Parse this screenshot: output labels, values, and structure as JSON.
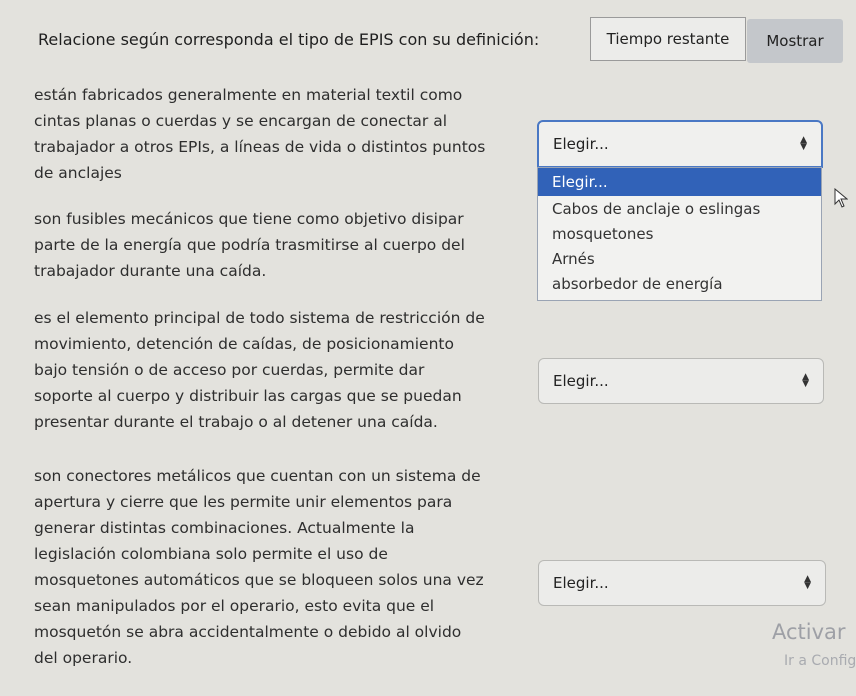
{
  "header": {
    "question": "Relacione según corresponda el tipo de EPIS con su definición:",
    "timer_label": "Tiempo restante",
    "show_button": "Mostrar"
  },
  "definitions": [
    {
      "lines": [
        "están fabricados generalmente en material textil como",
        "cintas planas o cuerdas y se encargan de conectar al",
        "trabajador a otros EPIs, a líneas de vida o distintos puntos",
        "de anclajes"
      ],
      "select_value": "Elegir..."
    },
    {
      "lines": [
        "son fusibles mecánicos que tiene como objetivo disipar",
        "parte de la energía que podría trasmitirse al cuerpo del",
        "trabajador durante una caída."
      ]
    },
    {
      "lines": [
        "es el elemento principal de todo sistema de restricción de",
        "movimiento, detención de caídas, de posicionamiento",
        "bajo tensión o de acceso por cuerdas, permite dar",
        "soporte al cuerpo y distribuir las cargas que se puedan",
        "presentar durante el trabajo o al detener una caída."
      ],
      "select_value": "Elegir..."
    },
    {
      "lines": [
        "son conectores metálicos que cuentan con un sistema de",
        "apertura y cierre que les permite unir elementos para",
        "generar distintas combinaciones. Actualmente la",
        "legislación colombiana solo permite el uso de",
        "mosquetones automáticos que se bloqueen solos una vez",
        "sean manipulados por el operario, esto evita que el",
        "mosquetón se abra accidentalmente o debido al olvido",
        "del operario."
      ],
      "select_value": "Elegir..."
    }
  ],
  "dropdown": {
    "options": [
      "Elegir...",
      "Cabos de anclaje o eslingas",
      "mosquetones",
      "Arnés",
      "absorbedor de energía"
    ]
  },
  "watermark": {
    "title": "Activar",
    "subtitle": "Ir a Config"
  }
}
